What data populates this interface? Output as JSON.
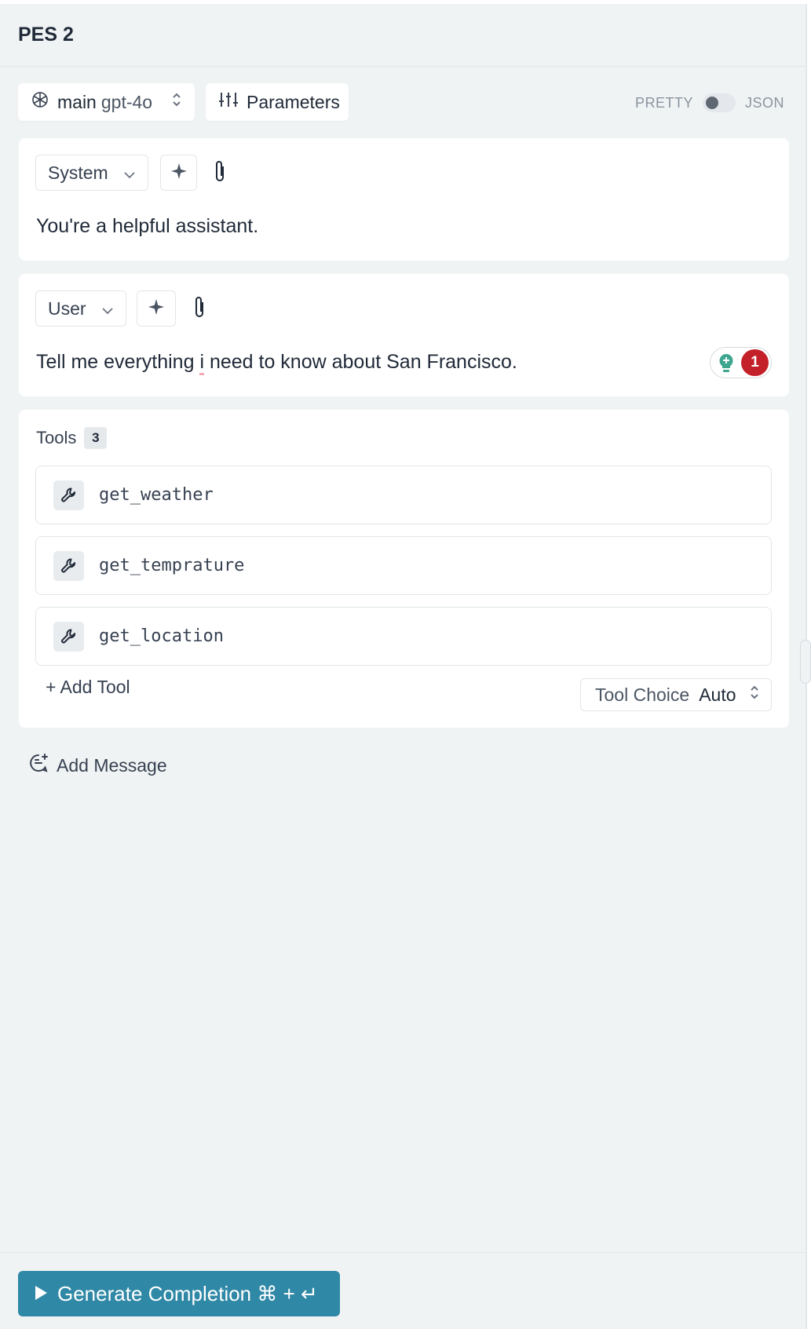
{
  "header": {
    "title": "PES 2"
  },
  "toolbar": {
    "model_prefix": "main",
    "model_name": "gpt-4o",
    "parameters_label": "Parameters",
    "pretty_label": "PRETTY",
    "json_label": "JSON"
  },
  "messages": [
    {
      "role": "System",
      "text": "You're a helpful assistant."
    },
    {
      "role": "User",
      "text_before": "Tell me everything ",
      "text_flagged": "i",
      "text_after": " need to know about San Francisco.",
      "suggestion_count": "1"
    }
  ],
  "tools": {
    "title": "Tools",
    "count": "3",
    "items": [
      "get_weather",
      "get_temprature",
      "get_location"
    ],
    "add_label": "+ Add Tool",
    "choice_label": "Tool Choice",
    "choice_value": "Auto"
  },
  "add_message_label": "Add Message",
  "generate_label": "Generate Completion ⌘ + ↵",
  "colors": {
    "accent": "#2f88a6",
    "badge": "#c4202a",
    "panel": "#f0f3f4"
  }
}
